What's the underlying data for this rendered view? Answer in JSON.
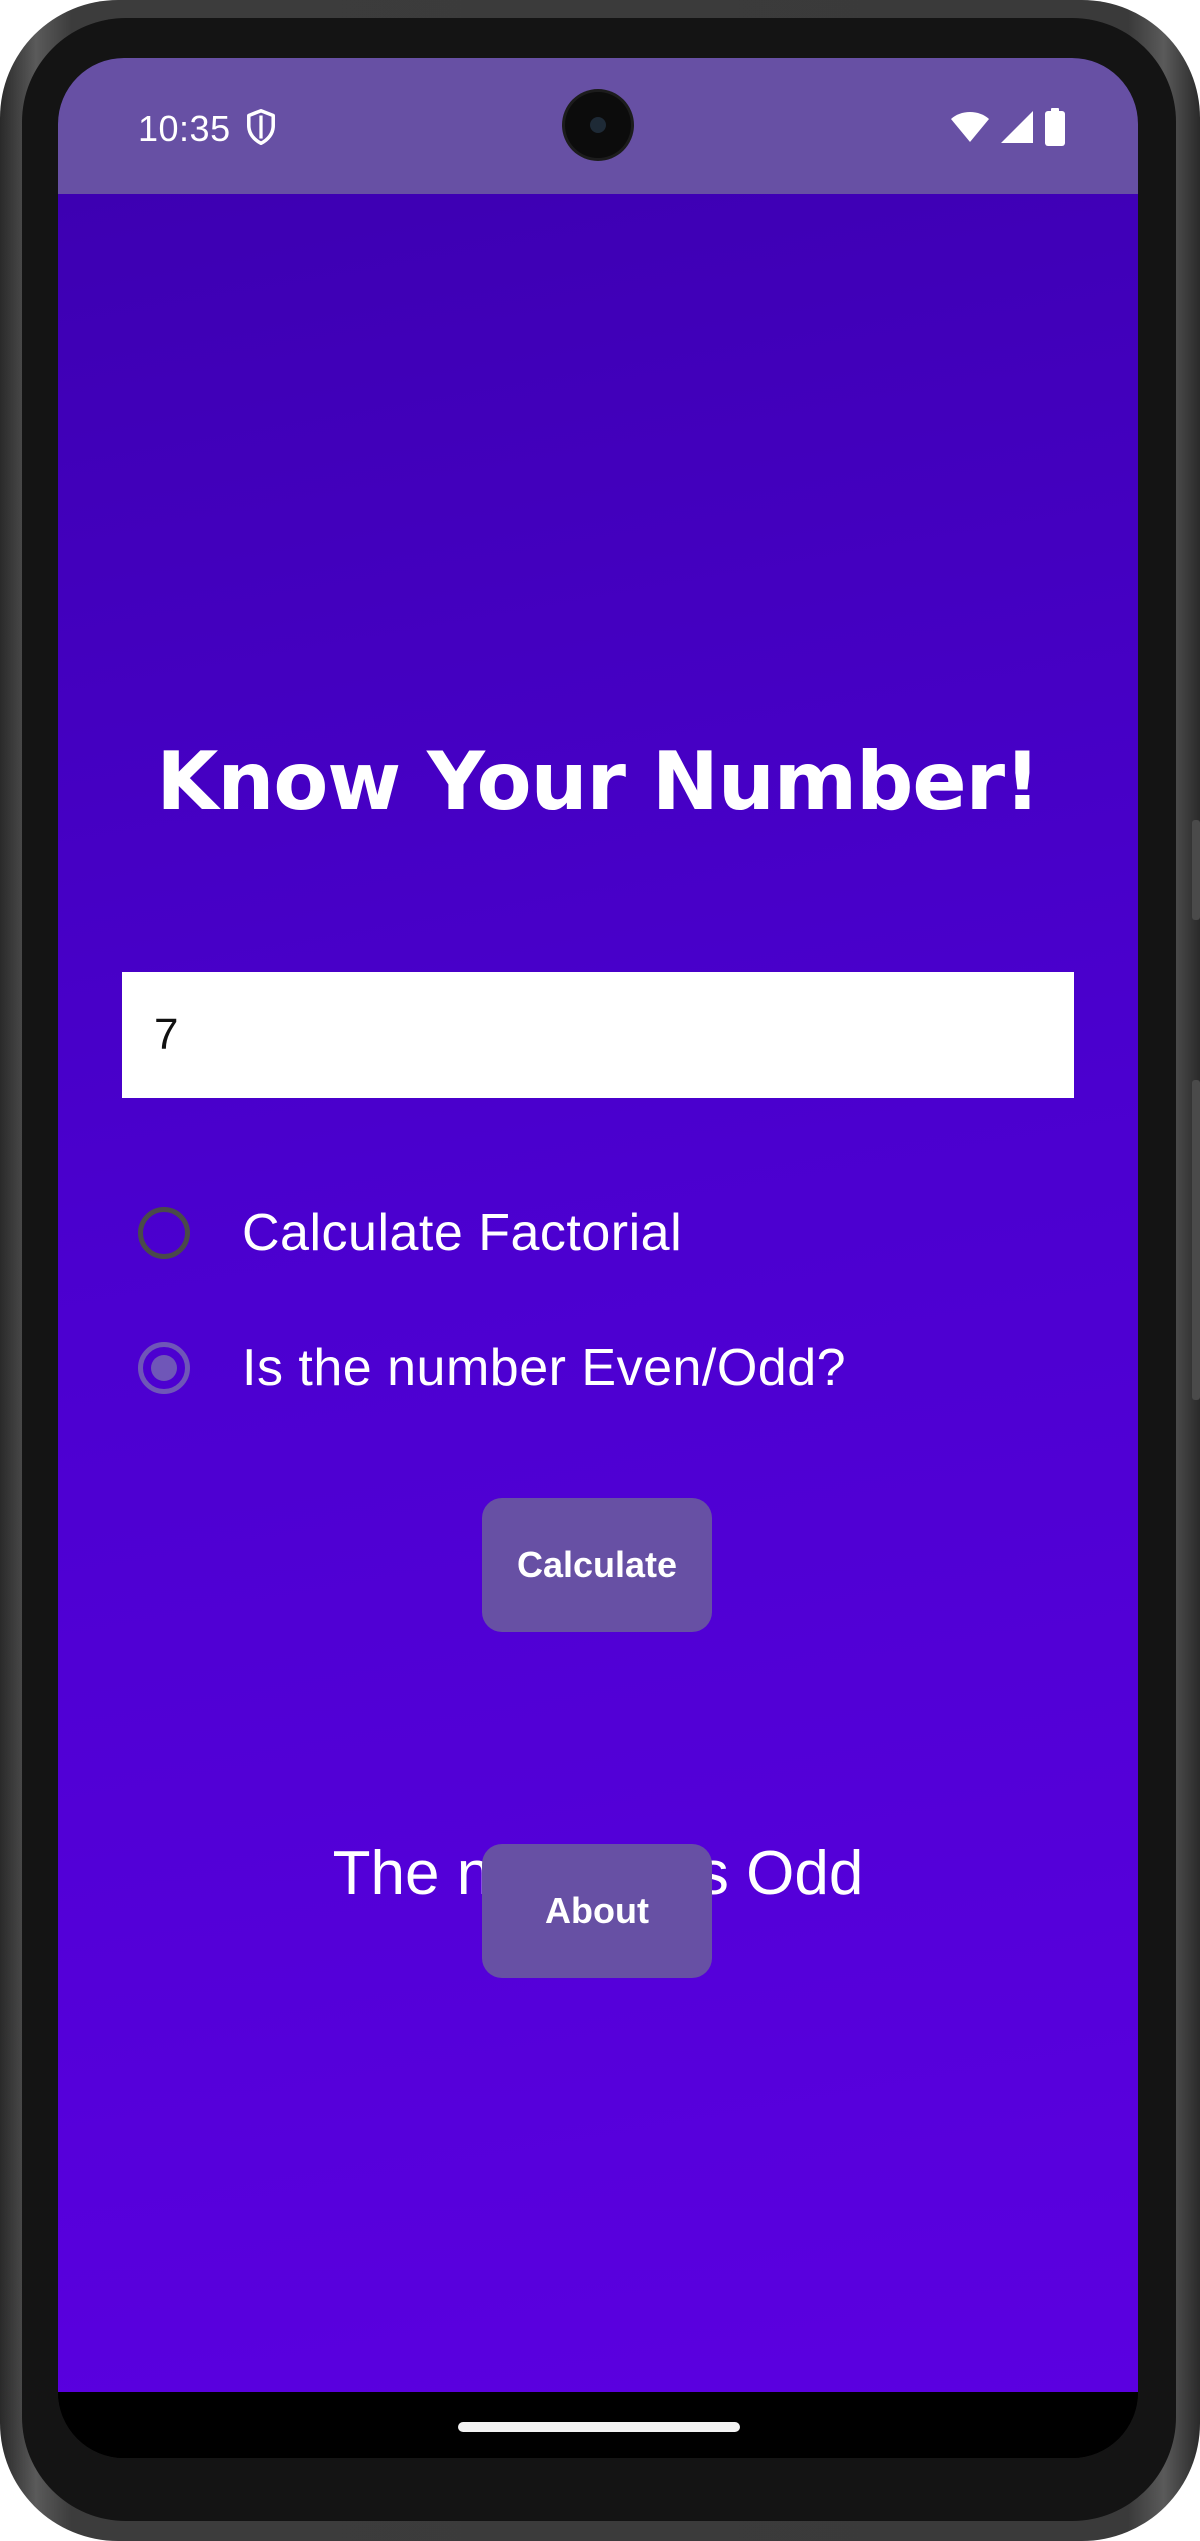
{
  "status_bar": {
    "time": "10:35",
    "shield_icon": "shield-icon",
    "wifi_icon": "wifi-icon",
    "signal_icon": "cellular-signal-icon",
    "battery_icon": "battery-icon",
    "color": "#6750a4"
  },
  "app": {
    "title": "Know Your Number!",
    "background_colors": [
      "#3d00b2",
      "#5b00e0"
    ],
    "number_input": {
      "value": "7",
      "placeholder": ""
    },
    "options": [
      {
        "label": "Calculate Factorial",
        "selected": false
      },
      {
        "label": "Is the number Even/Odd?",
        "selected": true
      }
    ],
    "calculate_button": {
      "label": "Calculate"
    },
    "result_text": "The number is Odd",
    "about_button": {
      "label": "About"
    },
    "button_color": "#6750a4"
  }
}
